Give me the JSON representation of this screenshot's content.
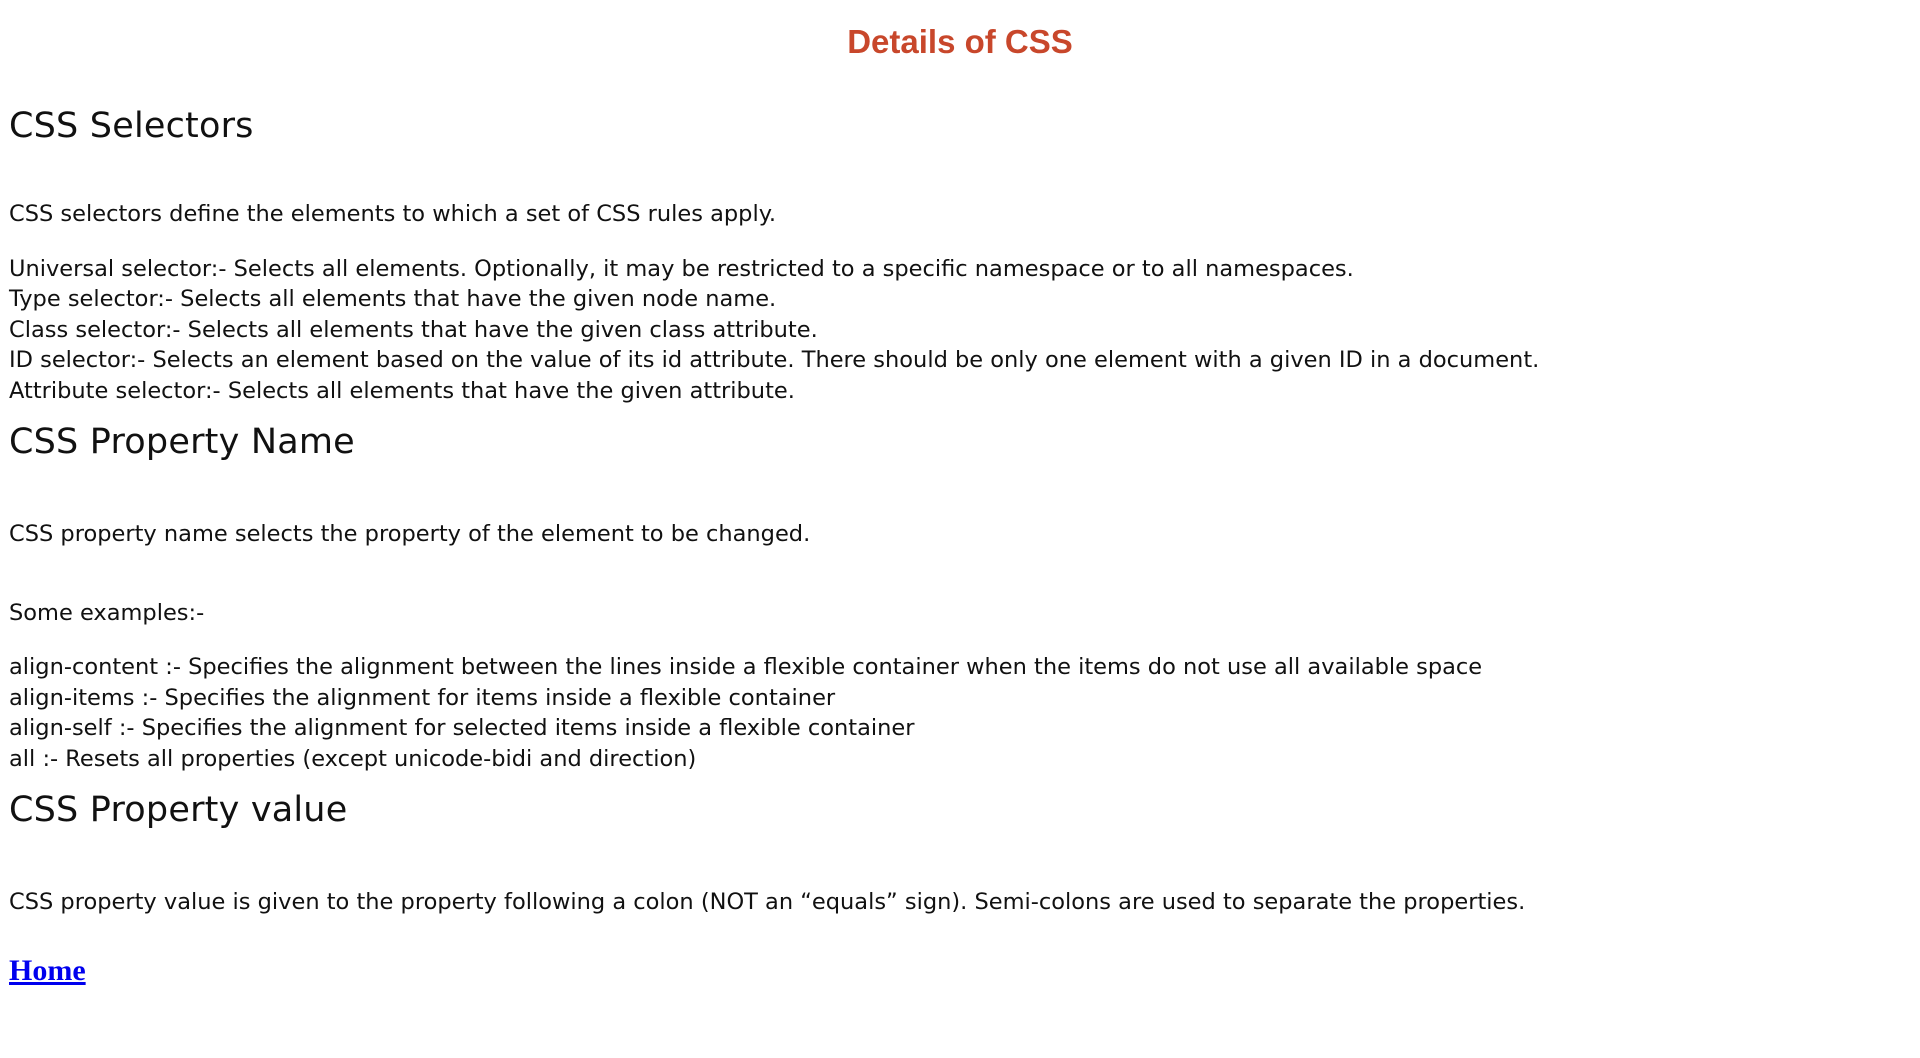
{
  "page_title": "Details of CSS",
  "sections": {
    "selectors": {
      "heading": "CSS Selectors",
      "intro": "CSS selectors define the elements to which a set of CSS rules apply.",
      "items": [
        "Universal selector:- Selects all elements. Optionally, it may be restricted to a specific namespace or to all namespaces.",
        "Type selector:- Selects all elements that have the given node name.",
        "Class selector:- Selects all elements that have the given class attribute.",
        "ID selector:- Selects an element based on the value of its id attribute. There should be only one element with a given ID in a document.",
        "Attribute selector:- Selects all elements that have the given attribute."
      ]
    },
    "property_name": {
      "heading": "CSS Property Name",
      "intro": "CSS property name selects the property of the element to be changed.",
      "examples_label": "Some examples:-",
      "items": [
        "align-content :- Specifies the alignment between the lines inside a flexible container when the items do not use all available space",
        "align-items :- Specifies the alignment for items inside a flexible container",
        "align-self :- Specifies the alignment for selected items inside a flexible container",
        "all :- Resets all properties (except unicode-bidi and direction)"
      ]
    },
    "property_value": {
      "heading": "CSS Property value",
      "intro": "CSS property value is given to the property following a colon (NOT an “equals” sign). Semi-colons are used to separate the properties."
    }
  },
  "home_link": {
    "label": "Home"
  },
  "colors": {
    "title": "#c8472b",
    "text": "#111111",
    "link": "#0000ee",
    "background": "#ffffff"
  }
}
